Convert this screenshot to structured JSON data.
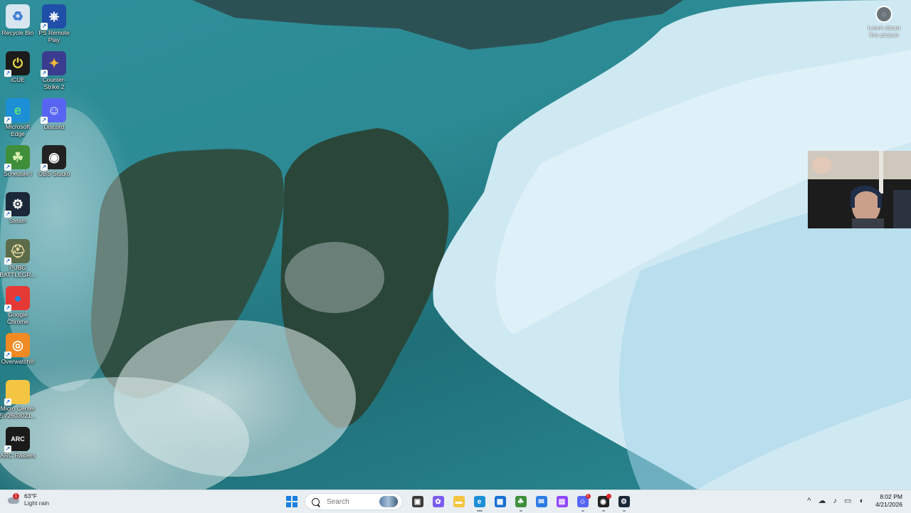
{
  "desktop": {
    "icons": [
      {
        "label": "Recycle Bin",
        "icon": "recycle-bin-icon",
        "glyph": "♻",
        "color": "#d8e6f0",
        "fg": "#3a7bd5"
      },
      {
        "label": "PS Remote Play",
        "icon": "ps-remote-play-icon",
        "glyph": "⎈",
        "color": "#1f4fa8",
        "fg": "#ffffff"
      },
      {
        "label": "iCUE",
        "icon": "icue-icon",
        "glyph": "⏻",
        "color": "#1b1b1b",
        "fg": "#f2e14a"
      },
      {
        "label": "Counter-Strike 2",
        "icon": "counter-strike-icon",
        "glyph": "✦",
        "color": "#3a3d8f",
        "fg": "#f2b632"
      },
      {
        "label": "Microsoft Edge",
        "icon": "edge-icon",
        "glyph": "e",
        "color": "#1d8fd6",
        "fg": "#5fe07a"
      },
      {
        "label": "Discord",
        "icon": "discord-icon",
        "glyph": "☺",
        "color": "#5865f2",
        "fg": "#ffffff"
      },
      {
        "label": "Schedule I",
        "icon": "schedule-one-icon",
        "glyph": "☘",
        "color": "#3f8f3a",
        "fg": "#d8f0b0"
      },
      {
        "label": "OBS Studio",
        "icon": "obs-studio-icon",
        "glyph": "◉",
        "color": "#222222",
        "fg": "#ffffff"
      },
      {
        "label": "Steam",
        "icon": "steam-icon",
        "glyph": "⚙",
        "color": "#1b2838",
        "fg": "#ffffff"
      },
      {
        "label": "PUBG BATTLEGR...",
        "icon": "pubg-icon",
        "glyph": "⛑",
        "color": "#5c6b4a",
        "fg": "#e8d9a0"
      },
      {
        "label": "Google Chrome",
        "icon": "chrome-icon",
        "glyph": "●",
        "color": "#e53935",
        "fg": "#1e88e5"
      },
      {
        "label": "Overwatch®",
        "icon": "overwatch-icon",
        "glyph": "◎",
        "color": "#f08a24",
        "fg": "#ffffff"
      },
      {
        "label": "Micro Center SV2603021...",
        "icon": "folder-icon",
        "glyph": "",
        "color": "#f4c542",
        "fg": "#ffffff"
      },
      {
        "label": "ARC Raiders",
        "icon": "arc-raiders-icon",
        "glyph": "ARC",
        "color": "#1a1a1a",
        "fg": "#ffffff"
      }
    ],
    "learn_label": "Learn about this picture"
  },
  "taskbar": {
    "weather": {
      "temp": "63°F",
      "condition": "Light rain",
      "badge": "1"
    },
    "search_placeholder": "Search",
    "apps": [
      {
        "name": "task-view-icon",
        "glyph": "▣",
        "color": "#3a3a3a",
        "state": ""
      },
      {
        "name": "copilot-icon",
        "glyph": "✿",
        "color": "#7b5cf0",
        "state": ""
      },
      {
        "name": "file-explorer-icon",
        "glyph": "▬",
        "color": "#f4c542",
        "state": ""
      },
      {
        "name": "edge-taskbar-icon",
        "glyph": "e",
        "color": "#1d8fd6",
        "state": "active"
      },
      {
        "name": "microsoft-store-icon",
        "glyph": "▦",
        "color": "#1a6fd0",
        "state": ""
      },
      {
        "name": "schedule-one-taskbar-icon",
        "glyph": "☘",
        "color": "#3f8f3a",
        "state": "running"
      },
      {
        "name": "outlook-icon",
        "glyph": "✉",
        "color": "#2d7be5",
        "state": ""
      },
      {
        "name": "twitch-icon",
        "glyph": "▤",
        "color": "#9146ff",
        "state": ""
      },
      {
        "name": "discord-taskbar-icon",
        "glyph": "☺",
        "color": "#5865f2",
        "state": "running",
        "dot": "1"
      },
      {
        "name": "obs-taskbar-icon",
        "glyph": "◉",
        "color": "#222222",
        "state": "running",
        "dot": " "
      },
      {
        "name": "steam-taskbar-icon",
        "glyph": "⚙",
        "color": "#1b2838",
        "state": "running"
      }
    ],
    "tray": [
      {
        "name": "show-hidden-icons-chevron-icon",
        "glyph": "^"
      },
      {
        "name": "onedrive-icon",
        "glyph": "☁"
      },
      {
        "name": "microphone-icon",
        "glyph": "♪"
      },
      {
        "name": "display-icon",
        "glyph": "▭"
      },
      {
        "name": "volume-icon",
        "glyph": "◖"
      }
    ],
    "clock": {
      "time": "8:02 PM",
      "date": "4/21/2026"
    }
  }
}
